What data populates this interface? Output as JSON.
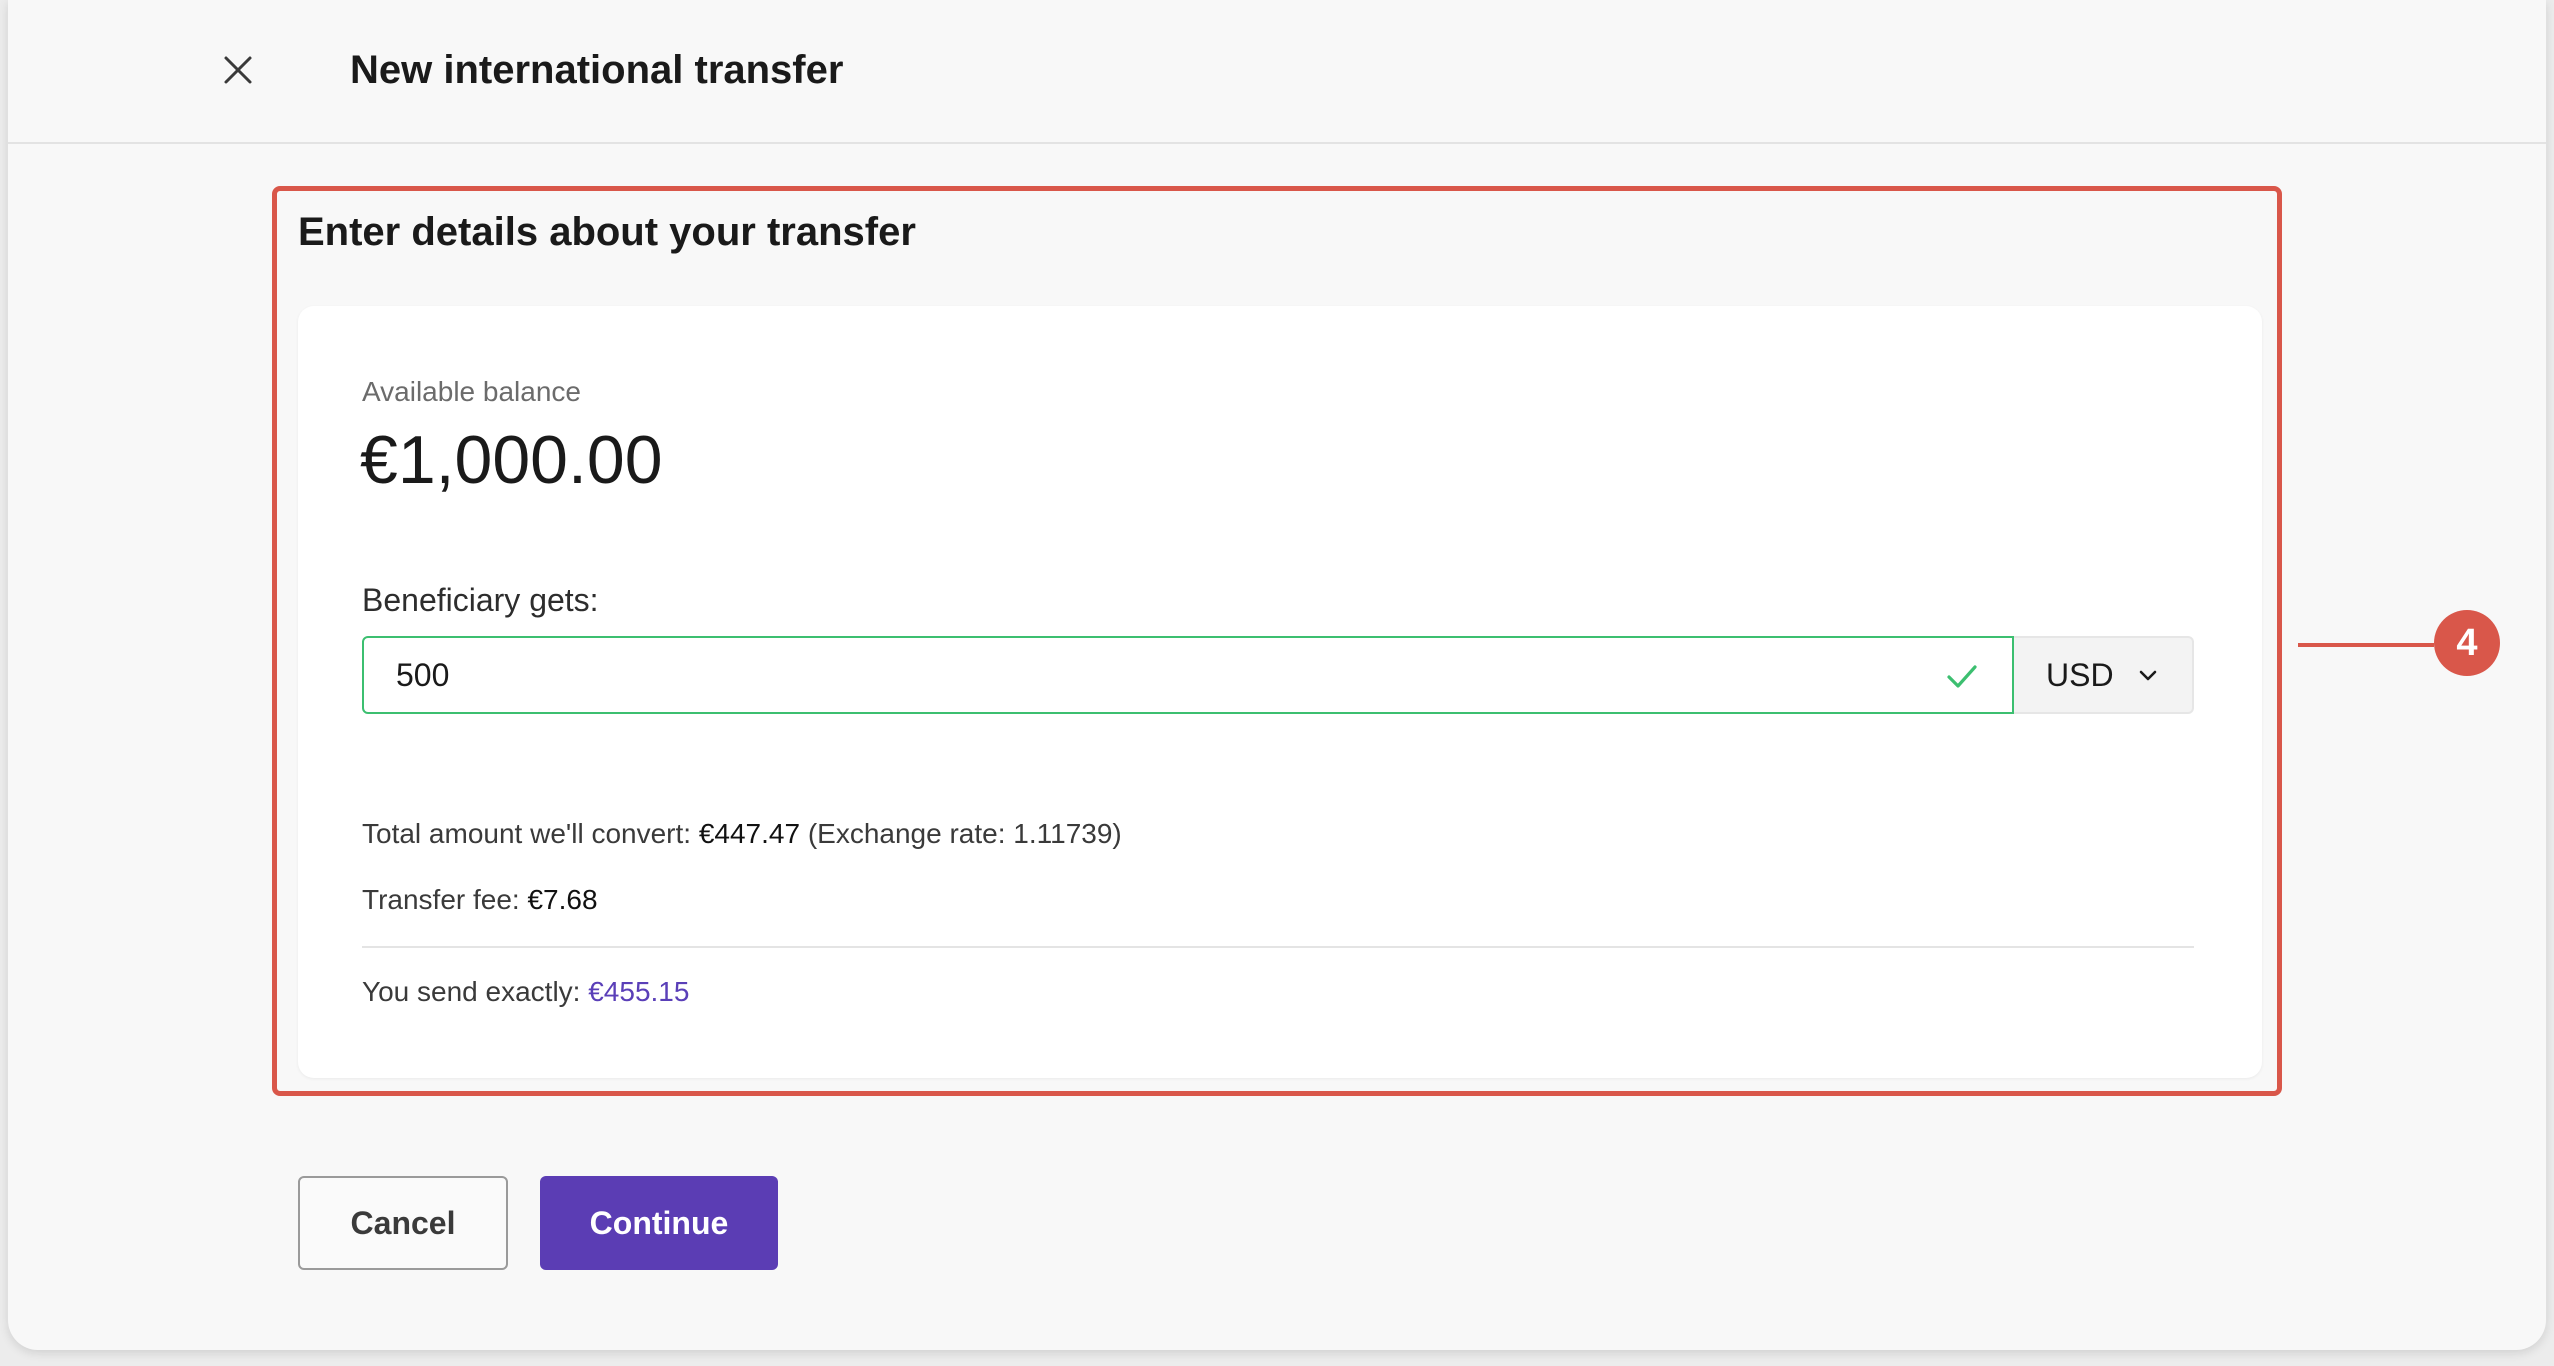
{
  "header": {
    "title": "New international transfer",
    "close_icon": "close-icon"
  },
  "section": {
    "title": "Enter details about your transfer"
  },
  "balance": {
    "label": "Available balance",
    "value": "€1,000.00"
  },
  "beneficiary": {
    "label": "Beneficiary gets:",
    "amount": "500",
    "currency": "USD",
    "valid_icon": "check-icon"
  },
  "summary": {
    "convert_label": "Total amount we'll convert:",
    "convert_amount": "€447.47",
    "exchange_rate": "(Exchange rate: 1.11739)",
    "fee_label": "Transfer fee:",
    "fee_amount": "€7.68",
    "send_label": "You send exactly:",
    "send_amount": "€455.15"
  },
  "callout": {
    "number": "4"
  },
  "actions": {
    "cancel_label": "Cancel",
    "continue_label": "Continue"
  },
  "colors": {
    "accent": "#5b3db4",
    "highlight": "#d9574a",
    "valid": "#3cbf70"
  }
}
